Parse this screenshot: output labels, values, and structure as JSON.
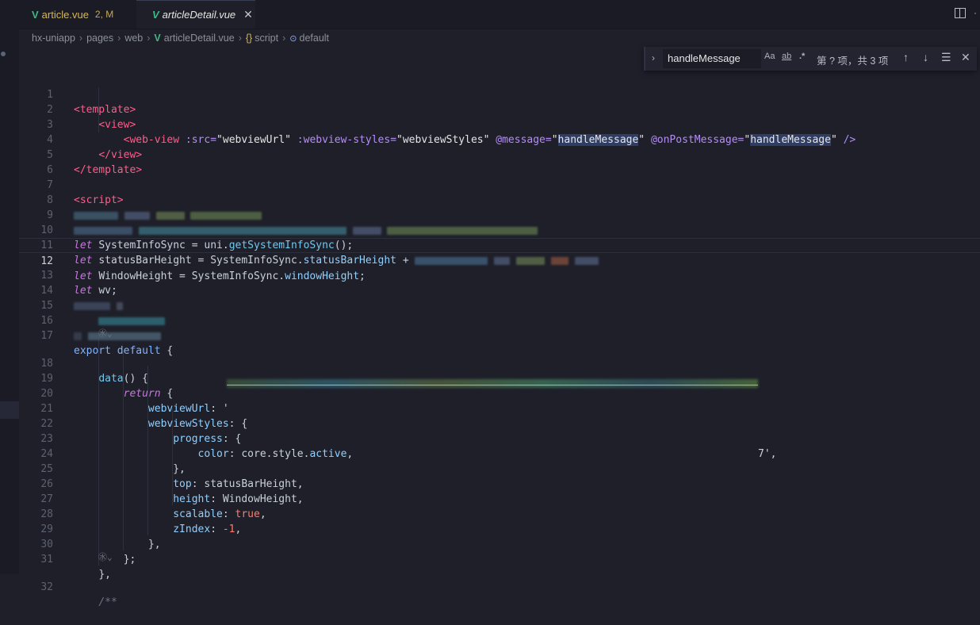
{
  "tabs": [
    {
      "name": "article.vue",
      "status": "2, M",
      "active": false
    },
    {
      "name": "articleDetail.vue",
      "status": "",
      "active": true
    }
  ],
  "breadcrumb": [
    "hx-uniapp",
    "pages",
    "web",
    "articleDetail.vue",
    "script",
    "default"
  ],
  "find": {
    "query": "handleMessage",
    "match_case": "Aa",
    "whole_word": "ab",
    "regex": ".*",
    "result": "第 ? 项，共 3 项"
  },
  "editor": {
    "current_line": 12,
    "line_numbers": [
      "1",
      "2",
      "3",
      "4",
      "5",
      "6",
      "7",
      "8",
      "9",
      "10",
      "11",
      "12",
      "13",
      "14",
      "15",
      "16",
      "17",
      "18",
      "19",
      "20",
      "21",
      "22",
      "23",
      "24",
      "25",
      "26",
      "27",
      "28",
      "29",
      "30",
      "31",
      "32"
    ],
    "code": {
      "l1": "<template>",
      "l2": "<view>",
      "l3_tag": "<web-view",
      "l3_src_attr": ":src=",
      "l3_src_val": "\"webviewUrl\"",
      "l3_styles_attr": ":webview-styles=",
      "l3_styles_val": "\"webviewStyles\"",
      "l3_msg_attr": "@message=",
      "l3_msg_val": "handleMessage",
      "l3_post_attr": "@onPostMessage=",
      "l3_post_val": "handleMessage",
      "l3_end": "/>",
      "l4": "</view>",
      "l5": "</template>",
      "l7": "<script>",
      "l10_kw": "let",
      "l10_name": "SystemInfoSync",
      "l10_rest": " = uni.",
      "l10_fn": "getSystemInfoSync",
      "l10_end": "();",
      "l11_kw": "let",
      "l11_rest": "statusBarHeight = SystemInfoSync.",
      "l11_prop": "statusBarHeight",
      "l11_end": " +",
      "l12_kw": "let",
      "l12_rest": "WindowHeight = SystemInfoSync.",
      "l12_prop": "windowHeight",
      "l12_end": ";",
      "l13_kw": "let",
      "l13_rest": "wv;",
      "l17_kw": "export default",
      "l17_end": " {",
      "l18_fn": "data",
      "l18_end": "() {",
      "l19_kw": "return",
      "l19_end": " {",
      "l20_key": "webviewUrl",
      "l20_mid": ": '",
      "l20_end": "7',",
      "l21_key": "webviewStyles",
      "l21_end": ": {",
      "l22_key": "progress",
      "l22_end": ": {",
      "l23_key": "color",
      "l23_rest": ": core.style.",
      "l23_prop": "active",
      "l23_end": ",",
      "l24": "},",
      "l25_key": "top",
      "l25_rest": ": statusBarHeight,",
      "l26_key": "height",
      "l26_rest": ": WindowHeight,",
      "l27_key": "scalable",
      "l27_sep": ": ",
      "l27_val": "true",
      "l27_end": ",",
      "l28_key": "zIndex",
      "l28_sep": ": ",
      "l28_val": "-1",
      "l28_end": ",",
      "l29": "},",
      "l30": "};",
      "l31": "},",
      "l32": "/**"
    }
  },
  "icons": {
    "vue": "V",
    "close": "✕",
    "chevron_right": "›",
    "arrow_up": "↑",
    "arrow_down": "↓",
    "selection": "☰",
    "find_close": "✕",
    "more": "·",
    "script_braces": "{}",
    "symbol": "⊙"
  },
  "colors": {
    "background": "#1e1f29",
    "tag": "#ff5c8a",
    "attr": "#b48ef5",
    "keyword": "#c678dd",
    "highlight": "#2f3d63"
  }
}
